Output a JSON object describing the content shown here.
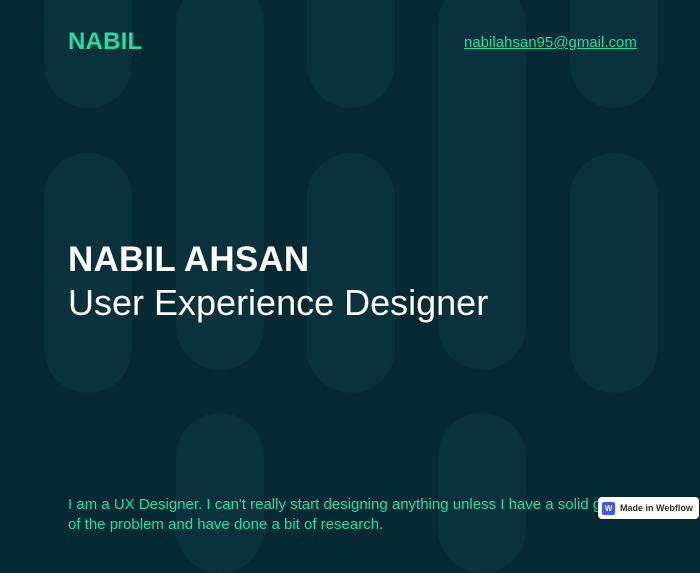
{
  "header": {
    "logo": "NABIL",
    "email": "nabilahsan95@gmail.com"
  },
  "hero": {
    "name": "NABIL AHSAN",
    "role": "User Experience Designer"
  },
  "intro": {
    "text": "I am a UX Designer. I can't really start designing anything unless I have a solid grasp of the problem and have done a bit of research."
  },
  "badge": {
    "label": "Made in Webflow",
    "icon": "webflow-icon"
  },
  "colors": {
    "background": "#062a33",
    "accent": "#1fe0a0",
    "pill": "#0a323c",
    "text": "#ffffff"
  }
}
